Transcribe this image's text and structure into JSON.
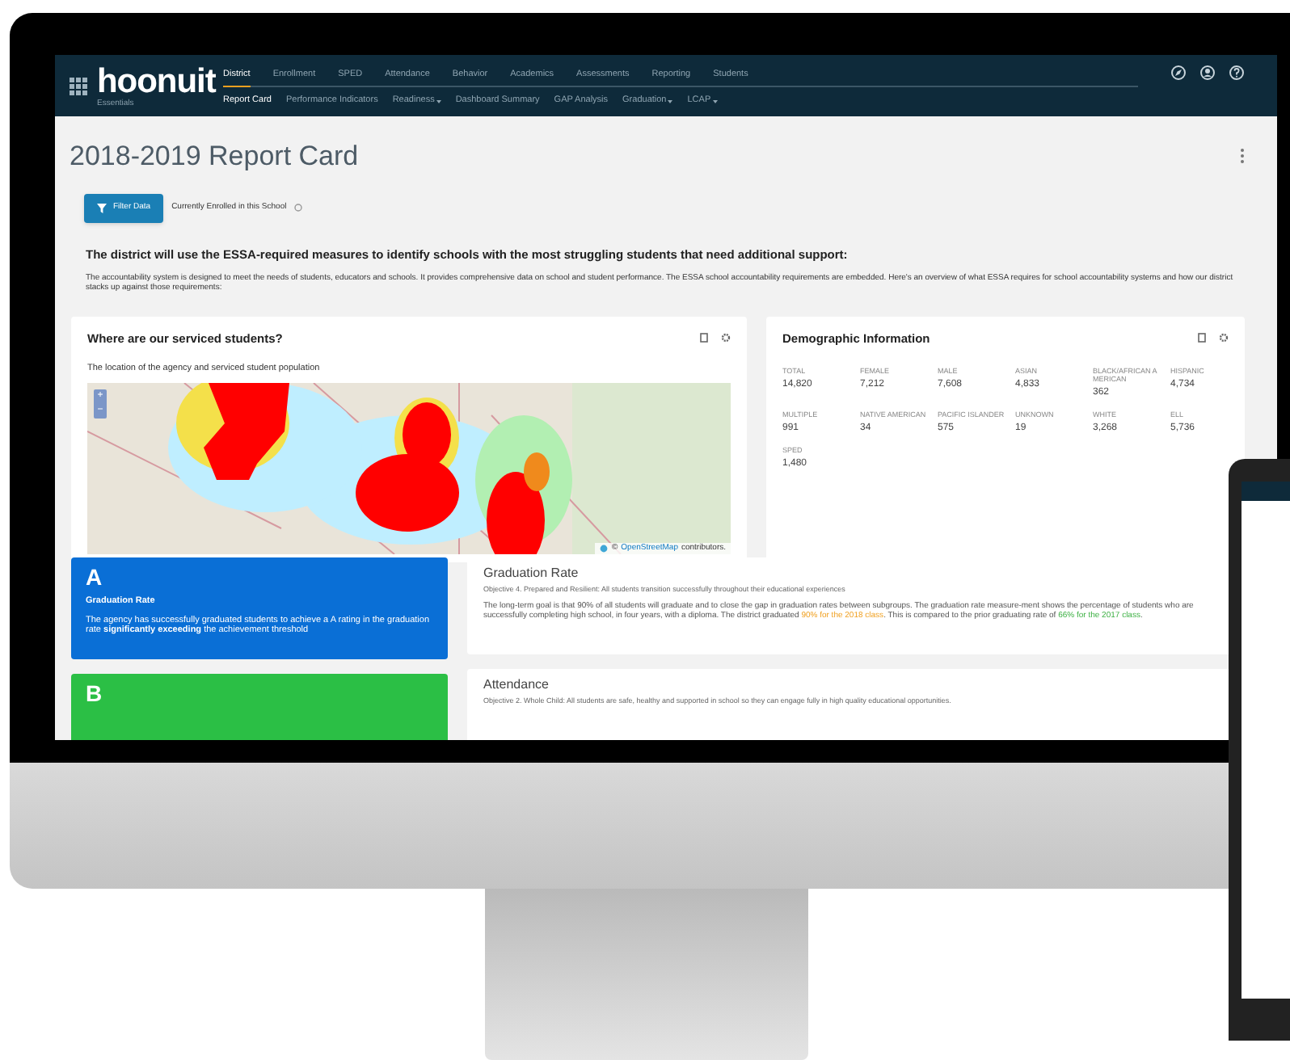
{
  "app": {
    "logo": "hoonuit",
    "logo_subtitle": "Essentials"
  },
  "nav": [
    {
      "label": "District",
      "selected": true
    },
    {
      "label": "Enrollment",
      "selected": false
    },
    {
      "label": "SPED",
      "selected": false
    },
    {
      "label": "Attendance",
      "selected": false
    },
    {
      "label": "Behavior",
      "selected": false
    },
    {
      "label": "Academics",
      "selected": false
    },
    {
      "label": "Assessments",
      "selected": false
    },
    {
      "label": "Reporting",
      "selected": false
    },
    {
      "label": "Students",
      "selected": false
    }
  ],
  "subnav": [
    {
      "label": "Report Card",
      "selected": true,
      "dropdown": false
    },
    {
      "label": "Performance Indicators",
      "selected": false,
      "dropdown": false
    },
    {
      "label": "Readiness",
      "selected": false,
      "dropdown": true
    },
    {
      "label": "Dashboard Summary",
      "selected": false,
      "dropdown": false
    },
    {
      "label": "GAP Analysis",
      "selected": false,
      "dropdown": false
    },
    {
      "label": "Graduation",
      "selected": false,
      "dropdown": true
    },
    {
      "label": "LCAP",
      "selected": false,
      "dropdown": true
    }
  ],
  "page_title": "2018-2019 Report Card",
  "filter_button": "Filter Data",
  "filter_status": "Currently Enrolled in this School",
  "intro_heading": "The district will use the ESSA-required measures to identify schools with the most struggling students that need additional support:",
  "intro_text": "The accountability system is designed to meet the needs of students, educators and schools. It provides comprehensive data on school and student performance. The ESSA school accountability requirements are embedded. Here's an overview of what ESSA requires for school accountability systems and how our district stacks up against those requirements:",
  "map_card": {
    "title": "Where are our serviced students?",
    "subtitle": "The location of the agency and serviced student population",
    "zoom_in": "+",
    "zoom_out": "−",
    "attribution_prefix": "©",
    "attribution_link": "OpenStreetMap",
    "attribution_suffix": "contributors."
  },
  "demographics": {
    "title": "Demographic Information",
    "items": [
      {
        "label": "TOTAL",
        "value": "14,820"
      },
      {
        "label": "FEMALE",
        "value": "7,212"
      },
      {
        "label": "MALE",
        "value": "7,608"
      },
      {
        "label": "ASIAN",
        "value": "4,833"
      },
      {
        "label": "BLACK/AFRICAN AMERICAN",
        "value": "362"
      },
      {
        "label": "HISPANIC",
        "value": "4,734"
      },
      {
        "label": "MULTIPLE",
        "value": "991"
      },
      {
        "label": "NATIVE AMERICAN",
        "value": "34"
      },
      {
        "label": "PACIFIC ISLANDER",
        "value": "575"
      },
      {
        "label": "UNKNOWN",
        "value": "19"
      },
      {
        "label": "WHITE",
        "value": "3,268"
      },
      {
        "label": "ELL",
        "value": "5,736"
      },
      {
        "label": "SPED",
        "value": "1,480"
      }
    ]
  },
  "grades": [
    {
      "grade": "A",
      "color": "#0a6fd6",
      "label": "Graduation Rate",
      "text": "The agency has successfully graduated students to achieve a A rating in the graduation rate **significantly exceeding** the achievement threshold"
    },
    {
      "grade": "B",
      "color": "#2bbf45"
    }
  ],
  "indicators": [
    {
      "title": "Graduation Rate",
      "objective": "Objective 4. Prepared and Resilient: All students transition successfully throughout their educational experiences",
      "segments": [
        {
          "text": "The long-term goal is that 90% of all students will graduate and to close the gap in graduation rates between subgroups. The graduation rate measure-ment shows the percentage of students who are successfully completing high school, in four years, with a diploma. The district graduated ",
          "kind": "plain"
        },
        {
          "text": "90% for the 2018 class",
          "kind": "current"
        },
        {
          "text": ". This is compared to the prior graduating rate of ",
          "kind": "plain"
        },
        {
          "text": "66% for the 2017 class",
          "kind": "prior"
        },
        {
          "text": ".",
          "kind": "plain"
        }
      ]
    },
    {
      "title": "Attendance",
      "objective": "Objective 2. Whole Child: All students are safe, healthy and supported in school so they can engage fully in high quality educational opportunities."
    }
  ]
}
